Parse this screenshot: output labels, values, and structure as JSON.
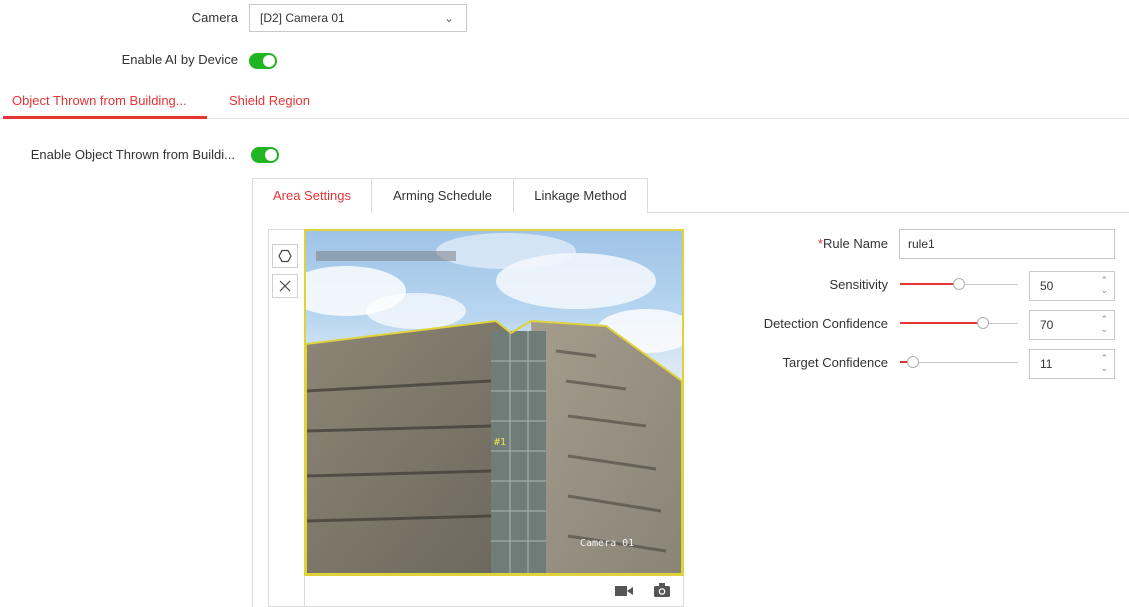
{
  "camera": {
    "label": "Camera",
    "value": "[D2] Camera 01"
  },
  "enable_ai": {
    "label": "Enable AI by Device",
    "enabled": true
  },
  "main_tabs": [
    {
      "label": "Object Thrown from Building...",
      "active": true
    },
    {
      "label": "Shield Region",
      "active": false
    }
  ],
  "enable_object": {
    "label": "Enable Object Thrown from Buildi...",
    "enabled": true
  },
  "sub_tabs": [
    {
      "label": "Area Settings",
      "active": true
    },
    {
      "label": "Arming Schedule",
      "active": false
    },
    {
      "label": "Linkage Method",
      "active": false
    }
  ],
  "tools": [
    "polygon-icon",
    "close-icon"
  ],
  "video": {
    "overlay_id": "#1",
    "overlay_camera": "Camera 01",
    "bar_icons": [
      "record-icon",
      "snapshot-icon"
    ]
  },
  "form": {
    "rule_name": {
      "required_mark": "*",
      "label": "Rule Name",
      "value": "rule1"
    },
    "sensitivity": {
      "label": "Sensitivity",
      "value": "50",
      "level": 50
    },
    "detection_confidence": {
      "label": "Detection Confidence",
      "value": "70",
      "level": 70
    },
    "target_confidence": {
      "label": "Target Confidence",
      "value": "11",
      "level": 11
    }
  },
  "colors": {
    "accent": "#e53434",
    "toggle_on": "#21b524",
    "area_outline": "#e0d23a"
  }
}
